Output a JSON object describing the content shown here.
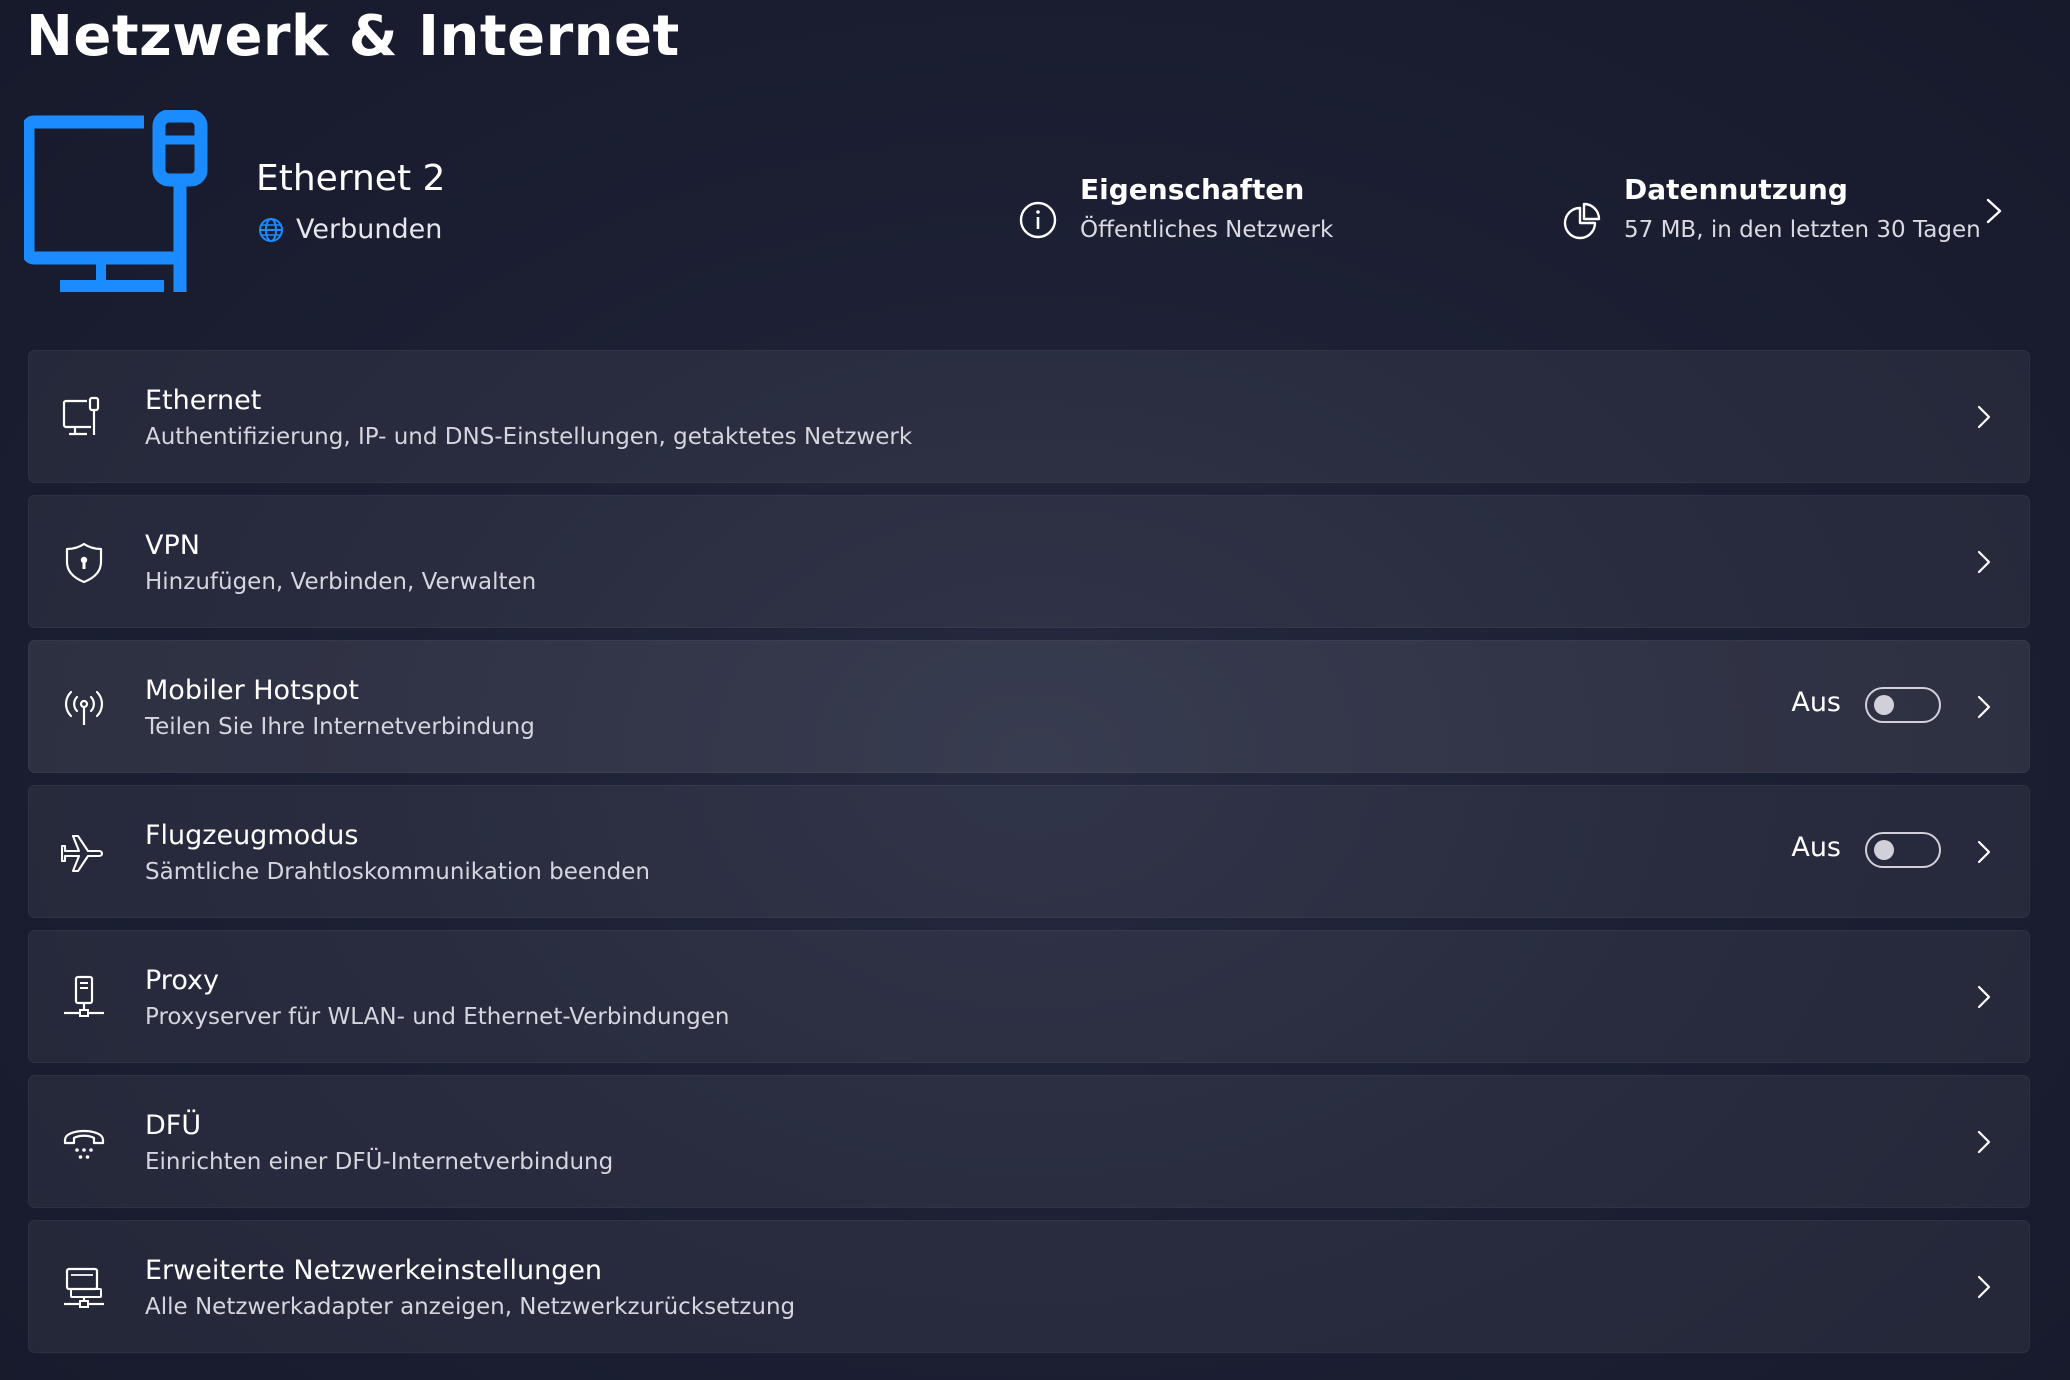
{
  "page": {
    "title": "Netzwerk & Internet"
  },
  "hero": {
    "device_icon": "ethernet-monitor-icon",
    "name": "Ethernet 2",
    "status": "Verbunden",
    "status_icon": "globe-icon",
    "accent_color": "#1a8cff",
    "properties": {
      "title": "Eigenschaften",
      "subtitle": "Öffentliches Netzwerk",
      "icon": "info-icon"
    },
    "data_usage": {
      "title": "Datennutzung",
      "subtitle": "57 MB, in den letzten 30 Tagen",
      "icon": "pie-chart-icon"
    }
  },
  "settings": [
    {
      "id": "ethernet",
      "icon": "ethernet-icon",
      "title": "Ethernet",
      "subtitle": "Authentifizierung, IP- und DNS-Einstellungen, getaktetes Netzwerk"
    },
    {
      "id": "vpn",
      "icon": "shield-icon",
      "title": "VPN",
      "subtitle": "Hinzufügen, Verbinden, Verwalten"
    },
    {
      "id": "hotspot",
      "icon": "hotspot-icon",
      "title": "Mobiler Hotspot",
      "subtitle": "Teilen Sie Ihre Internetverbindung",
      "toggle_label": "Aus",
      "toggle_on": false
    },
    {
      "id": "airplane",
      "icon": "airplane-icon",
      "title": "Flugzeugmodus",
      "subtitle": "Sämtliche Drahtloskommunikation beenden",
      "toggle_label": "Aus",
      "toggle_on": false
    },
    {
      "id": "proxy",
      "icon": "proxy-icon",
      "title": "Proxy",
      "subtitle": "Proxyserver für WLAN- und Ethernet-Verbindungen"
    },
    {
      "id": "dialup",
      "icon": "dialup-phone-icon",
      "title": "DFÜ",
      "subtitle": "Einrichten einer DFÜ-Internetverbindung"
    },
    {
      "id": "advanced",
      "icon": "network-adapter-icon",
      "title": "Erweiterte Netzwerkeinstellungen",
      "subtitle": "Alle Netzwerkadapter anzeigen, Netzwerkzurücksetzung"
    }
  ]
}
